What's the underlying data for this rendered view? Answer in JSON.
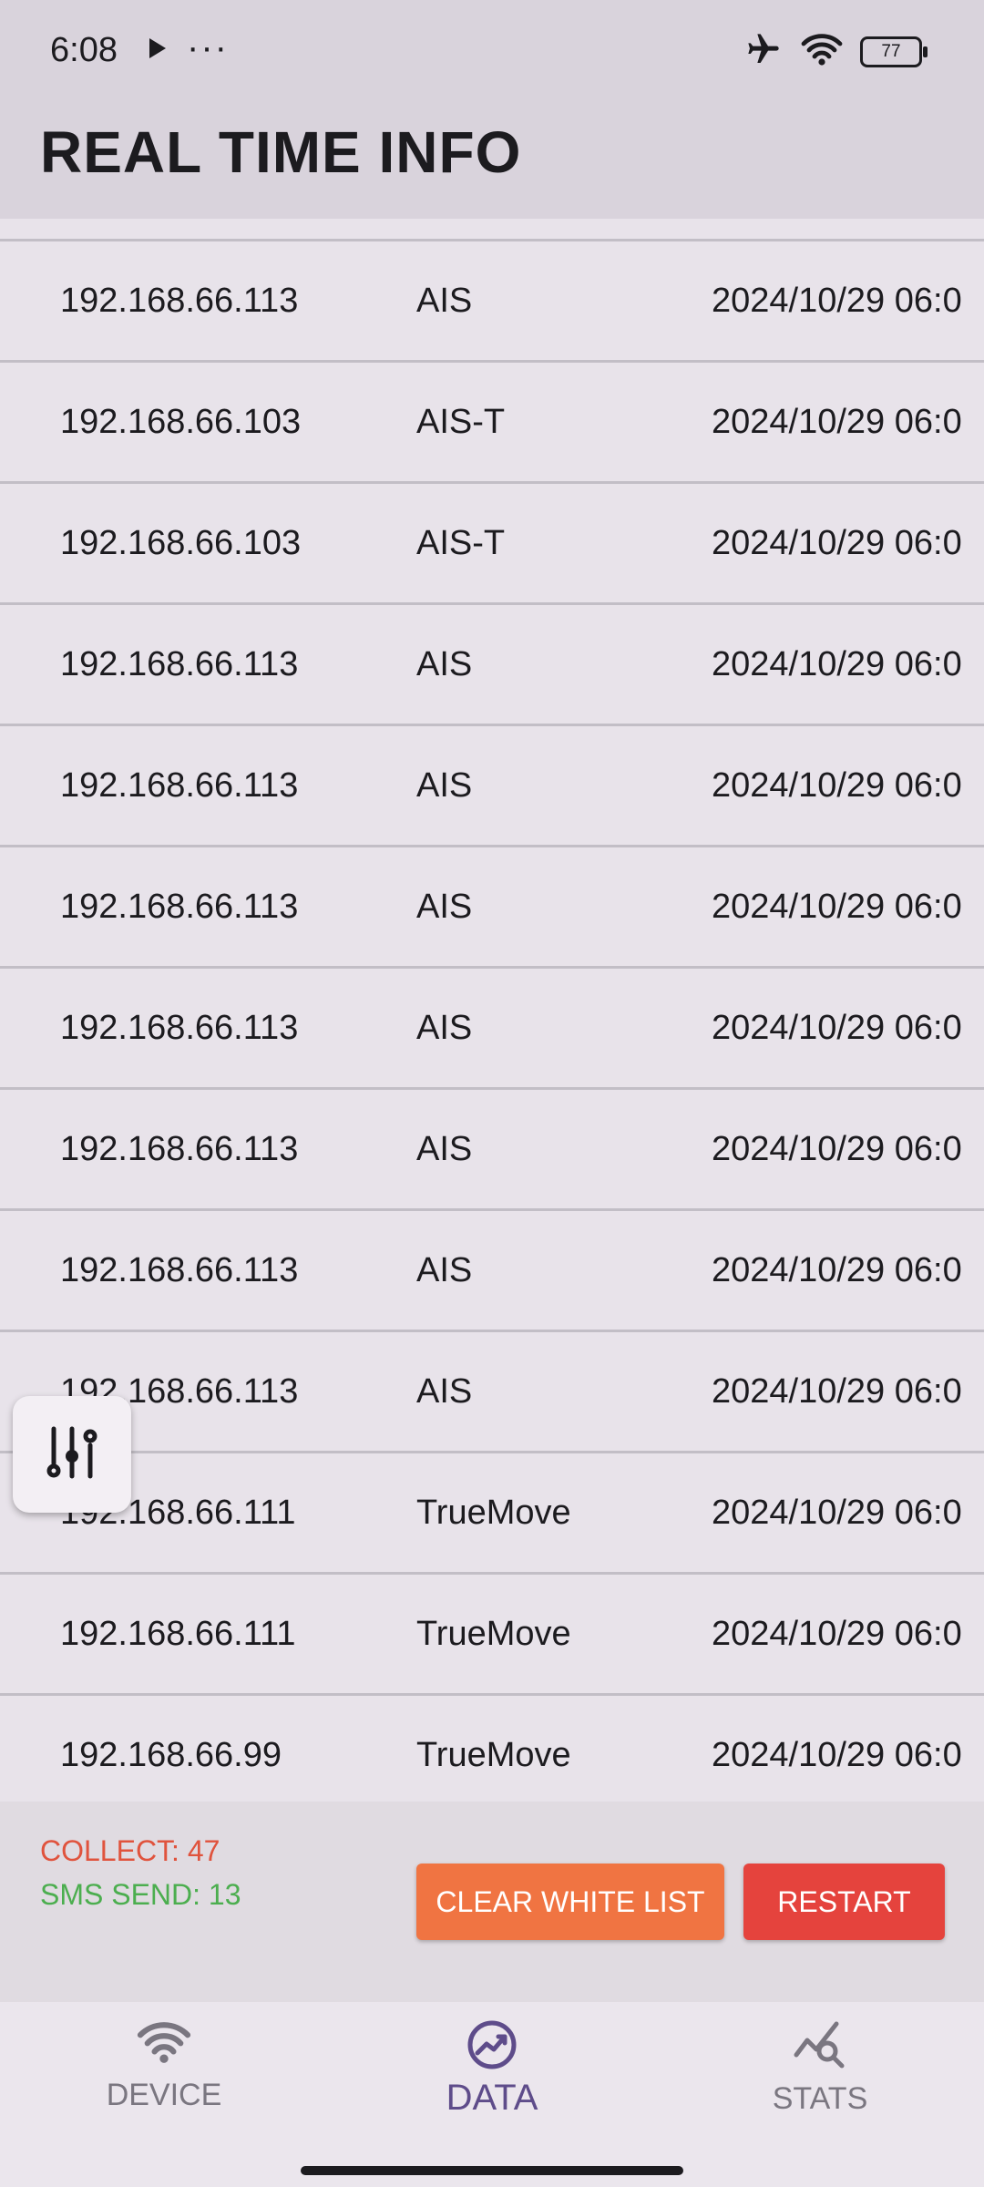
{
  "status_bar": {
    "time": "6:08",
    "dots": "···",
    "battery": "77"
  },
  "app_bar": {
    "title": "REAL TIME INFO"
  },
  "rows": [
    {
      "ip": "192.168.66.113",
      "operator": "AIS",
      "time": "2024/10/29 06:0"
    },
    {
      "ip": "192.168.66.103",
      "operator": "AIS-T",
      "time": "2024/10/29 06:0"
    },
    {
      "ip": "192.168.66.103",
      "operator": "AIS-T",
      "time": "2024/10/29 06:0"
    },
    {
      "ip": "192.168.66.113",
      "operator": "AIS",
      "time": "2024/10/29 06:0"
    },
    {
      "ip": "192.168.66.113",
      "operator": "AIS",
      "time": "2024/10/29 06:0"
    },
    {
      "ip": "192.168.66.113",
      "operator": "AIS",
      "time": "2024/10/29 06:0"
    },
    {
      "ip": "192.168.66.113",
      "operator": "AIS",
      "time": "2024/10/29 06:0"
    },
    {
      "ip": "192.168.66.113",
      "operator": "AIS",
      "time": "2024/10/29 06:0"
    },
    {
      "ip": "192.168.66.113",
      "operator": "AIS",
      "time": "2024/10/29 06:0"
    },
    {
      "ip": "192.168.66.113",
      "operator": "AIS",
      "time": "2024/10/29 06:0"
    },
    {
      "ip": "192.168.66.111",
      "operator": "TrueMove",
      "time": "2024/10/29 06:0"
    },
    {
      "ip": "192.168.66.111",
      "operator": "TrueMove",
      "time": "2024/10/29 06:0"
    },
    {
      "ip": "192.168.66.99",
      "operator": "TrueMove",
      "time": "2024/10/29 06:0"
    }
  ],
  "summary": {
    "collect": "COLLECT: 47",
    "sms_send": "SMS SEND: 13"
  },
  "actions": {
    "clear_white_list": "CLEAR WHITE LIST",
    "restart": "RESTART"
  },
  "nav": {
    "device": "DEVICE",
    "data": "DATA",
    "stats": "STATS",
    "active": "data"
  },
  "colors": {
    "collect": "#e0533d",
    "sms": "#4cae4f",
    "clear_button": "#f07442",
    "restart_button": "#e5433d",
    "nav_active": "#5e4c8a"
  },
  "icons": {
    "filter_fab": "sliders-icon",
    "device": "wifi-icon",
    "data": "chart-trend-icon",
    "stats": "stats-search-icon"
  }
}
